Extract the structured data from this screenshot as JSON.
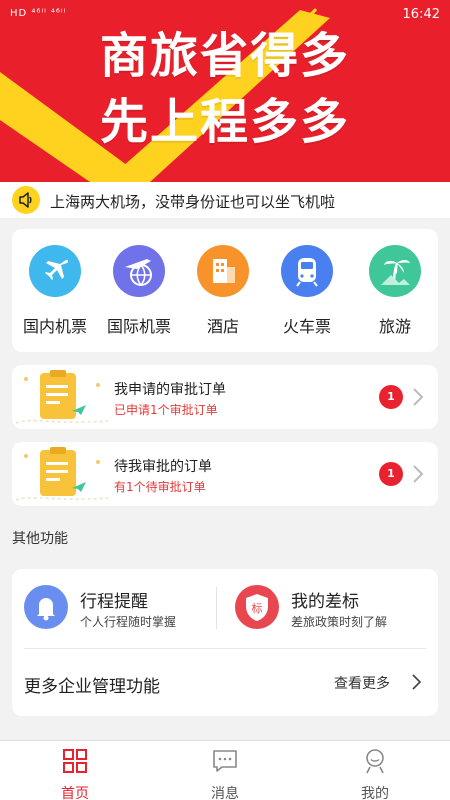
{
  "status_bar": {
    "left_text": "HD ⁴⁶ˡˡ ⁴⁶ˡˡ",
    "right_text": "N ⚿ ▭ 16:42",
    "time": "16:42"
  },
  "banner": {
    "line1": "商旅省得多",
    "line2": "先上程多多",
    "bg_color": "#e9202b",
    "accent_color": "#ffd21f"
  },
  "notice": {
    "text": "上海两大机场，没带身份证也可以坐飞机啦",
    "icon": "speaker-icon"
  },
  "services": [
    {
      "label": "国内机票",
      "icon": "plane-icon",
      "color": "#3fb8ee"
    },
    {
      "label": "国际机票",
      "icon": "globe-plane-icon",
      "color": "#6f72e8"
    },
    {
      "label": "酒店",
      "icon": "hotel-icon",
      "color": "#f7932a"
    },
    {
      "label": "火车票",
      "icon": "train-icon",
      "color": "#4a7fef"
    },
    {
      "label": "旅游",
      "icon": "palm-tree-icon",
      "color": "#3fc79a"
    }
  ],
  "approvals": [
    {
      "title": "我申请的审批订单",
      "subtitle": "已申请1个审批订单",
      "badge": "1"
    },
    {
      "title": "待我审批的订单",
      "subtitle": "有1个待审批订单",
      "badge": "1"
    }
  ],
  "other_section": {
    "title": "其他功能",
    "functions": [
      {
        "title": "行程提醒",
        "subtitle": "个人行程随时掌握",
        "icon": "bell-icon",
        "color": "#6a8ef0"
      },
      {
        "title": "我的差标",
        "subtitle": "差旅政策时刻了解",
        "icon": "shield-badge-icon",
        "color": "#e8474f"
      }
    ],
    "more_label": "更多企业管理功能",
    "more_link": "查看更多"
  },
  "tabs": [
    {
      "label": "首页",
      "icon": "home-grid-icon",
      "active": true
    },
    {
      "label": "消息",
      "icon": "message-icon",
      "active": false
    },
    {
      "label": "我的",
      "icon": "profile-icon",
      "active": false
    }
  ]
}
